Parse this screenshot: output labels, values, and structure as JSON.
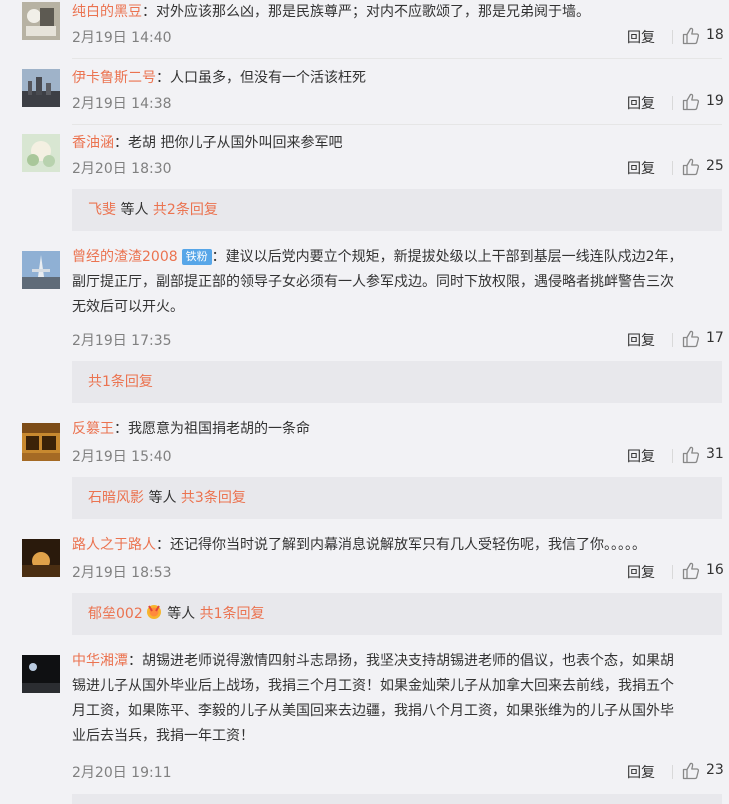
{
  "comments": [
    {
      "user": "纯白的黑豆",
      "text": "对外应该那么凶，那是民族尊严；对内不应歌颂了，那是兄弟阋于墙。",
      "time": "2月19日 14:40",
      "likes": "18"
    },
    {
      "user": "伊卡鲁斯二号",
      "text": "人口虽多，但没有一个活该枉死",
      "time": "2月19日 14:38",
      "likes": "19"
    },
    {
      "user": "香油涵",
      "text": "老胡 把你儿子从国外叫回来参军吧",
      "time": "2月20日 18:30",
      "likes": "25",
      "subreplies": {
        "name": "飞斐",
        "middle": "等人",
        "total": "共2条回复"
      }
    },
    {
      "user": "曾经的渣渣2008",
      "badge": "铁粉",
      "text_lines": [
        "建议以后党内要立个规矩，新提拔处级以上干部到基层一线连队戍边2年，",
        "副厅提正厅，副部提正部的领导子女必须有一人参军戍边。同时下放权限，遇侵略者挑衅警告三次",
        "无效后可以开火。"
      ],
      "time": "2月19日 17:35",
      "likes": "17",
      "subreplies": {
        "total": "共1条回复"
      }
    },
    {
      "user": "反篡王",
      "text": "我愿意为祖国捐老胡的一条命",
      "time": "2月19日 15:40",
      "likes": "31",
      "subreplies": {
        "name": "石暗风影",
        "middle": "等人",
        "total": "共3条回复"
      }
    },
    {
      "user": "路人之于路人",
      "text": "还记得你当时说了解到内幕消息说解放军只有几人受轻伤呢，我信了你。。。。。",
      "time": "2月19日 18:53",
      "likes": "16",
      "subreplies": {
        "name": "郁垒002",
        "middle": "等人",
        "total": "共1条回复"
      }
    },
    {
      "user": "中华湘潭",
      "text_lines": [
        "胡锡进老师说得激情四射斗志昂扬，我坚决支持胡锡进老师的倡议，也表个态，如果胡",
        "锡进儿子从国外毕业后上战场，我捐三个月工资！如果金灿荣儿子从加拿大回来去前线，我捐五个",
        "月工资，如果陈平、李毅的儿子从美国回来去边疆，我捐八个月工资，如果张维为的儿子从国外毕",
        "业后去当兵，我捐一年工资！"
      ],
      "time": "2月20日 19:11",
      "likes": "23"
    }
  ],
  "labels": {
    "reply": "回复",
    "colon": "："
  },
  "icons": {
    "like": "thumbs-up-icon",
    "medal": "medal-icon"
  },
  "colors": {
    "username": "#eb7350",
    "badge": "#57a6e8",
    "background": "#f2f2f5"
  }
}
